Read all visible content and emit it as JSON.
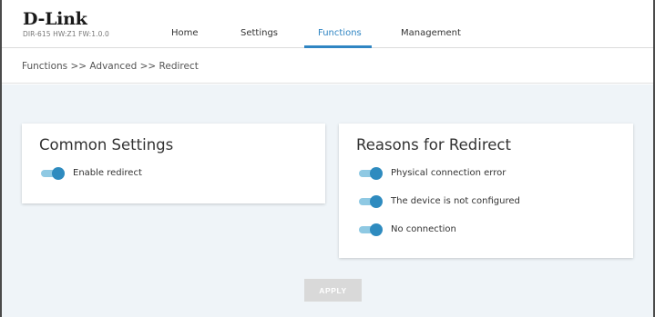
{
  "header": {
    "logo": "D-Link",
    "model_info": "DIR-615 HW:Z1 FW:1.0.0",
    "nav": [
      {
        "label": "Home",
        "active": false
      },
      {
        "label": "Settings",
        "active": false
      },
      {
        "label": "Functions",
        "active": true
      },
      {
        "label": "Management",
        "active": false
      }
    ]
  },
  "breadcrumb": "Functions >> Advanced >> Redirect",
  "common_settings": {
    "title": "Common Settings",
    "toggles": [
      {
        "label": "Enable redirect",
        "on": true
      }
    ]
  },
  "reasons": {
    "title": "Reasons for Redirect",
    "toggles": [
      {
        "label": "Physical connection error",
        "on": true
      },
      {
        "label": "The device is not configured",
        "on": true
      },
      {
        "label": "No connection",
        "on": true
      }
    ]
  },
  "apply_label": "APPLY",
  "colors": {
    "accent": "#2f85c3",
    "toggle_knob": "#2e8bbf",
    "toggle_track": "#8fc9e3",
    "content_bg": "#eff4f8",
    "apply_bg": "#d9d9d9"
  }
}
